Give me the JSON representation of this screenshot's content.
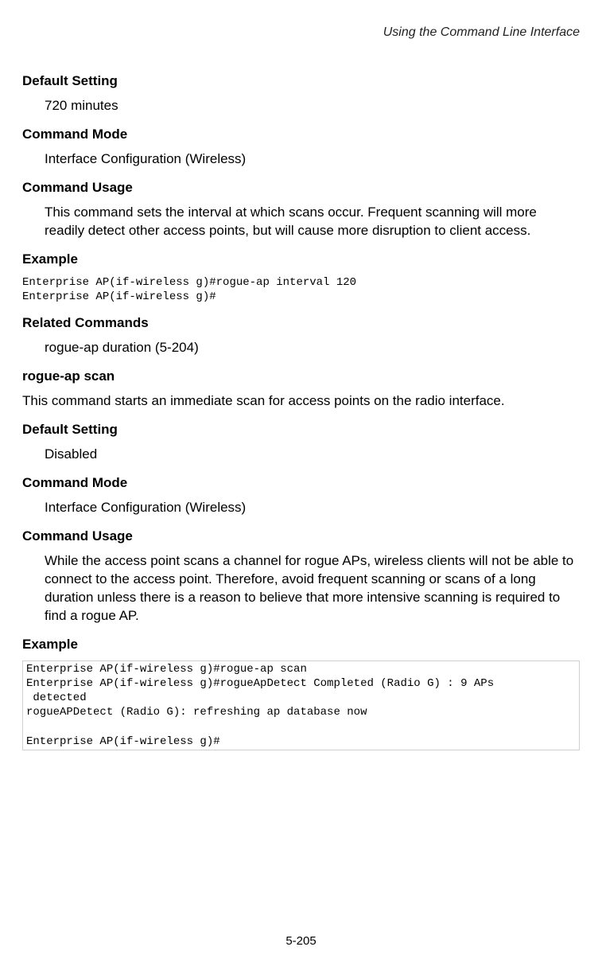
{
  "header": {
    "running_title": "Using the Command Line Interface"
  },
  "section1": {
    "default_setting_label": "Default Setting",
    "default_setting_value": "720 minutes",
    "command_mode_label": "Command Mode",
    "command_mode_value": "Interface Configuration (Wireless)",
    "command_usage_label": "Command Usage",
    "command_usage_value": "This command sets the interval at which scans occur. Frequent scanning will more readily detect other access points, but will cause more disruption to client access.",
    "example_label": "Example",
    "example_code": "Enterprise AP(if-wireless g)#rogue-ap interval 120\nEnterprise AP(if-wireless g)#",
    "related_commands_label": "Related Commands",
    "related_commands_value": "rogue-ap duration (5-204)"
  },
  "section2": {
    "command_name": "rogue-ap scan",
    "command_description": "This command starts an immediate scan for access points on the radio interface.",
    "default_setting_label": "Default Setting",
    "default_setting_value": "Disabled",
    "command_mode_label": "Command Mode",
    "command_mode_value": "Interface Configuration (Wireless)",
    "command_usage_label": "Command Usage",
    "command_usage_value": "While the access point scans a channel for rogue APs, wireless clients will not be able to connect to the access point. Therefore, avoid frequent scanning or scans of a long duration unless there is a reason to believe that more intensive scanning is required to find a rogue AP.",
    "example_label": "Example",
    "example_code": "Enterprise AP(if-wireless g)#rogue-ap scan\nEnterprise AP(if-wireless g)#rogueApDetect Completed (Radio G) : 9 APs \n detected\nrogueAPDetect (Radio G): refreshing ap database now\n\nEnterprise AP(if-wireless g)#"
  },
  "footer": {
    "page_number": "5-205"
  }
}
